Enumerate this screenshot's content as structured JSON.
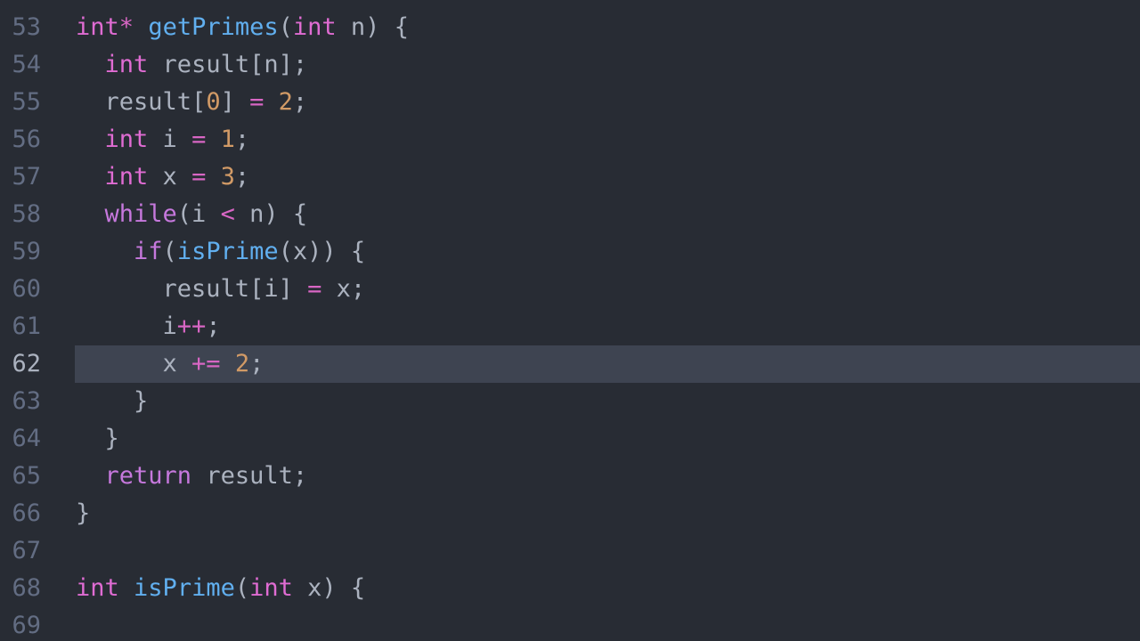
{
  "editor": {
    "language": "C",
    "background_color": "#282c34",
    "gutter_color": "#282c34",
    "active_line_color": "#3e4451",
    "default_text_color": "#abb2bf",
    "line_number_color": "#636d83",
    "active_line_number_color": "#abb2bf",
    "active_line": 62,
    "first_visible_line": 53,
    "last_visible_line": 69,
    "palette": {
      "keyword": "#c678dd",
      "type": "#e06cd3",
      "function": "#61afef",
      "number": "#d19a66",
      "operator": "#d866c4",
      "plain": "#abb2bf"
    }
  },
  "lines": [
    {
      "number": "53",
      "active": false,
      "tokens": [
        {
          "text": "int",
          "kind": "type"
        },
        {
          "text": "*",
          "kind": "operator"
        },
        {
          "text": " ",
          "kind": "plain"
        },
        {
          "text": "getPrimes",
          "kind": "function"
        },
        {
          "text": "(",
          "kind": "plain"
        },
        {
          "text": "int",
          "kind": "type"
        },
        {
          "text": " n) {",
          "kind": "plain"
        }
      ]
    },
    {
      "number": "54",
      "active": false,
      "tokens": [
        {
          "text": "  ",
          "kind": "plain"
        },
        {
          "text": "int",
          "kind": "type"
        },
        {
          "text": " result[n];",
          "kind": "plain"
        }
      ]
    },
    {
      "number": "55",
      "active": false,
      "tokens": [
        {
          "text": "  result[",
          "kind": "plain"
        },
        {
          "text": "0",
          "kind": "number"
        },
        {
          "text": "] ",
          "kind": "plain"
        },
        {
          "text": "=",
          "kind": "operator"
        },
        {
          "text": " ",
          "kind": "plain"
        },
        {
          "text": "2",
          "kind": "number"
        },
        {
          "text": ";",
          "kind": "plain"
        }
      ]
    },
    {
      "number": "56",
      "active": false,
      "tokens": [
        {
          "text": "  ",
          "kind": "plain"
        },
        {
          "text": "int",
          "kind": "type"
        },
        {
          "text": " i ",
          "kind": "plain"
        },
        {
          "text": "=",
          "kind": "operator"
        },
        {
          "text": " ",
          "kind": "plain"
        },
        {
          "text": "1",
          "kind": "number"
        },
        {
          "text": ";",
          "kind": "plain"
        }
      ]
    },
    {
      "number": "57",
      "active": false,
      "tokens": [
        {
          "text": "  ",
          "kind": "plain"
        },
        {
          "text": "int",
          "kind": "type"
        },
        {
          "text": " x ",
          "kind": "plain"
        },
        {
          "text": "=",
          "kind": "operator"
        },
        {
          "text": " ",
          "kind": "plain"
        },
        {
          "text": "3",
          "kind": "number"
        },
        {
          "text": ";",
          "kind": "plain"
        }
      ]
    },
    {
      "number": "58",
      "active": false,
      "tokens": [
        {
          "text": "  ",
          "kind": "plain"
        },
        {
          "text": "while",
          "kind": "keyword"
        },
        {
          "text": "(i ",
          "kind": "plain"
        },
        {
          "text": "<",
          "kind": "operator"
        },
        {
          "text": " n) {",
          "kind": "plain"
        }
      ]
    },
    {
      "number": "59",
      "active": false,
      "tokens": [
        {
          "text": "    ",
          "kind": "plain"
        },
        {
          "text": "if",
          "kind": "keyword"
        },
        {
          "text": "(",
          "kind": "plain"
        },
        {
          "text": "isPrime",
          "kind": "function"
        },
        {
          "text": "(x)) {",
          "kind": "plain"
        }
      ]
    },
    {
      "number": "60",
      "active": false,
      "tokens": [
        {
          "text": "      result[i] ",
          "kind": "plain"
        },
        {
          "text": "=",
          "kind": "operator"
        },
        {
          "text": " x;",
          "kind": "plain"
        }
      ]
    },
    {
      "number": "61",
      "active": false,
      "tokens": [
        {
          "text": "      i",
          "kind": "plain"
        },
        {
          "text": "++",
          "kind": "operator"
        },
        {
          "text": ";",
          "kind": "plain"
        }
      ]
    },
    {
      "number": "62",
      "active": true,
      "tokens": [
        {
          "text": "      x ",
          "kind": "plain"
        },
        {
          "text": "+=",
          "kind": "operator"
        },
        {
          "text": " ",
          "kind": "plain"
        },
        {
          "text": "2",
          "kind": "number"
        },
        {
          "text": ";",
          "kind": "plain"
        }
      ]
    },
    {
      "number": "63",
      "active": false,
      "tokens": [
        {
          "text": "    }",
          "kind": "plain"
        }
      ]
    },
    {
      "number": "64",
      "active": false,
      "tokens": [
        {
          "text": "  }",
          "kind": "plain"
        }
      ]
    },
    {
      "number": "65",
      "active": false,
      "tokens": [
        {
          "text": "  ",
          "kind": "plain"
        },
        {
          "text": "return",
          "kind": "keyword"
        },
        {
          "text": " result;",
          "kind": "plain"
        }
      ]
    },
    {
      "number": "66",
      "active": false,
      "tokens": [
        {
          "text": "}",
          "kind": "plain"
        }
      ]
    },
    {
      "number": "67",
      "active": false,
      "tokens": []
    },
    {
      "number": "68",
      "active": false,
      "tokens": [
        {
          "text": "int",
          "kind": "type"
        },
        {
          "text": " ",
          "kind": "plain"
        },
        {
          "text": "isPrime",
          "kind": "function"
        },
        {
          "text": "(",
          "kind": "plain"
        },
        {
          "text": "int",
          "kind": "type"
        },
        {
          "text": " x) {",
          "kind": "plain"
        }
      ]
    },
    {
      "number": "69",
      "active": false,
      "tokens": []
    }
  ]
}
